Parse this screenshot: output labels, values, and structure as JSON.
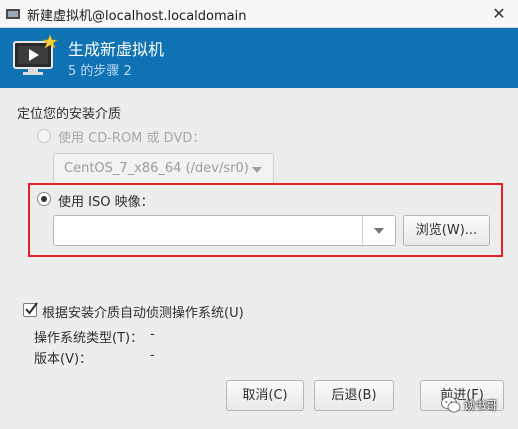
{
  "window": {
    "title": "新建虚拟机@localhost.localdomain",
    "close_glyph": "✕"
  },
  "banner": {
    "heading": "生成新虚拟机",
    "step": "5 的步骤 2",
    "icon": "monitor-new-vm-icon",
    "accent_color": "#0f72b3"
  },
  "install_media": {
    "section_title": "定位您的安装介质",
    "cdrom": {
      "label": "使用 CD-ROM 或 DVD：",
      "selected": false,
      "enabled": false,
      "device_value": "CentOS_7_x86_64 (/dev/sr0)"
    },
    "iso": {
      "label": "使用 ISO 映像：",
      "selected": true,
      "path_value": "",
      "browse_label": "浏览(W)...",
      "highlight_color": "#e6202a"
    }
  },
  "auto_detect": {
    "label": "根据安装介质自动侦测操作系统(U)",
    "checked": true
  },
  "os_info": {
    "type_label": "操作系统类型(T)：",
    "type_value": "-",
    "version_label": "版本(V)：",
    "version_value": "-"
  },
  "buttons": {
    "cancel": "取消(C)",
    "back": "后退(B)",
    "forward": "前进(F)"
  },
  "watermark": {
    "text": "读书哥"
  }
}
